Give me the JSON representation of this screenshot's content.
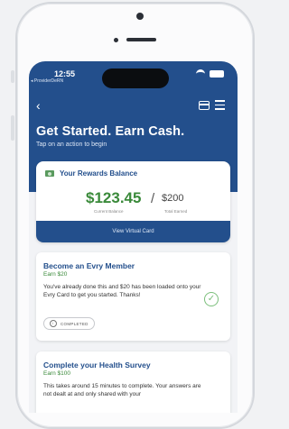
{
  "status_bar": {
    "time": "12:55",
    "back_app": "◂ ProviderDeRN"
  },
  "header": {
    "title": "Get Started. Earn Cash.",
    "subtitle": "Tap on an action to begin"
  },
  "rewards": {
    "title": "Your Rewards Balance",
    "current_amount": "$123.45",
    "current_label": "Current Balance",
    "total_amount": "$200",
    "total_label": "Total Earned",
    "button_label": "View Virtual Card"
  },
  "tasks": [
    {
      "title": "Become an Evry Member",
      "earn": "Earn $20",
      "body": "You've already done this and $20 has been loaded onto your Evry Card to get you started. Thanks!",
      "status": "COMPLETED"
    },
    {
      "title": "Complete your Health Survey",
      "earn": "Earn $100",
      "body": "This takes around 15 minutes to complete. Your answers are not dealt at and only shared with your"
    }
  ],
  "colors": {
    "brand": "#234f8c",
    "money": "#3a8a3a"
  }
}
